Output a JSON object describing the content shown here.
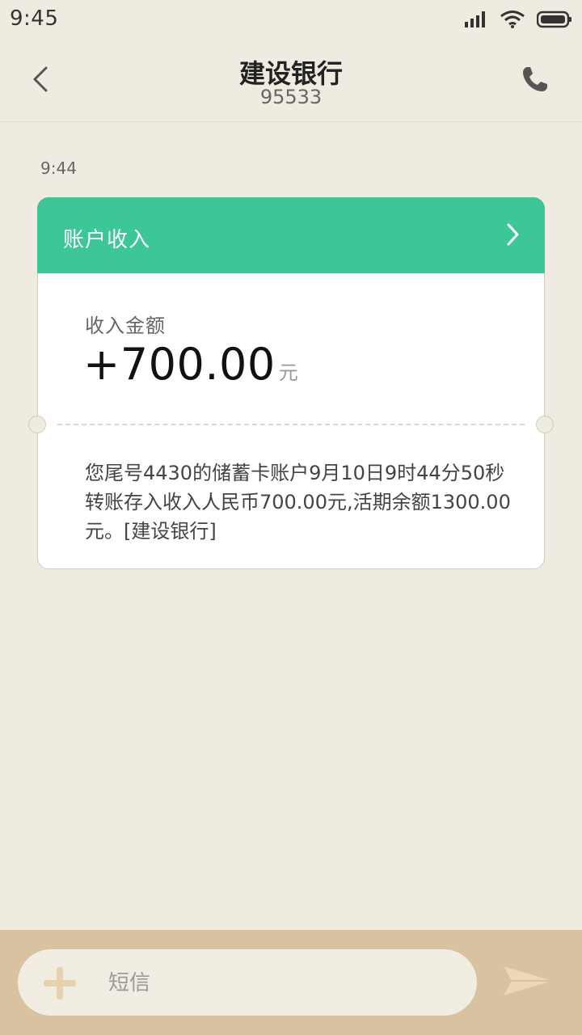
{
  "status_bar": {
    "time": "9:45",
    "icons": [
      "signal-icon",
      "wifi-icon",
      "battery-icon"
    ]
  },
  "header": {
    "title": "建设银行",
    "subtitle": "95533",
    "icons": [
      "back-icon",
      "phone-icon"
    ]
  },
  "conversation": {
    "timestamp": "9:44",
    "card": {
      "title": "账户收入",
      "amount_label": "收入金额",
      "amount": "+700.00",
      "unit": "元",
      "body": "您尾号4430的储蓄卡账户9月10日9时44分50秒转账存入收入人民币700.00元,活期余额1300.00元。[建设银行]"
    }
  },
  "composer": {
    "placeholder": "短信",
    "value": "",
    "icons": [
      "plus-icon",
      "send-icon"
    ]
  },
  "colors": {
    "background": "#f0ebe0",
    "card_header": "#3ec796",
    "composer_bar": "#d8c2a0"
  }
}
